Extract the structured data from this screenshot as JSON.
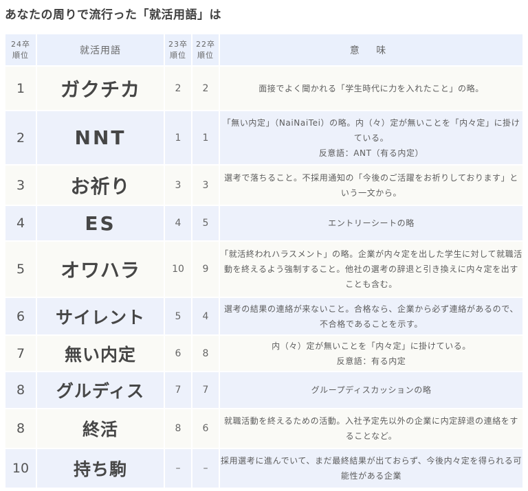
{
  "title": "あなたの周りで流行った「就活用語」は",
  "table": {
    "headers": {
      "rank24": [
        "24卒",
        "順位"
      ],
      "term": "就活用語",
      "rank23": [
        "23卒",
        "順位"
      ],
      "rank22": [
        "22卒",
        "順位"
      ],
      "meaning": "意 味"
    },
    "rows": [
      {
        "rank24": "1",
        "term": "ガクチカ",
        "rank23": "2",
        "rank22": "2",
        "meaning": [
          "面接でよく聞かれる「学生時代に力を入れたこと」の略。"
        ]
      },
      {
        "rank24": "2",
        "term": "NNT",
        "rank23": "1",
        "rank22": "1",
        "meaning": [
          "「無い内定」（NaiNaiTei）の略。内（々）定が無いことを「内々定」に掛けている。",
          "反意語：ANT（有る内定）"
        ]
      },
      {
        "rank24": "3",
        "term": "お祈り",
        "rank23": "3",
        "rank22": "3",
        "meaning": [
          "選考で落ちること。不採用通知の「今後のご活躍をお祈りしております」という一文から。"
        ]
      },
      {
        "rank24": "4",
        "term": "ES",
        "rank23": "4",
        "rank22": "5",
        "meaning": [
          "エントリーシートの略"
        ]
      },
      {
        "rank24": "5",
        "term": "オワハラ",
        "rank23": "10",
        "rank22": "9",
        "meaning": [
          "「就活終われハラスメント」の略。企業が内々定を出した学生に対して就職活動を終えるよう強制すること。他社の選考の辞退と引き換えに内々定を出すことも含む。"
        ]
      },
      {
        "rank24": "6",
        "term": "サイレント",
        "rank23": "5",
        "rank22": "4",
        "meaning": [
          "選考の結果の連絡が来ないこと。合格なら、企業から必ず連絡があるので、不合格であることを示す。"
        ]
      },
      {
        "rank24": "7",
        "term": "無い内定",
        "rank23": "6",
        "rank22": "8",
        "meaning": [
          "内（々）定が無いことを「内々定」に掛けている。",
          "反意語：有る内定"
        ]
      },
      {
        "rank24": "8",
        "term": "グルディス",
        "rank23": "7",
        "rank22": "7",
        "meaning": [
          "グループディスカッションの略"
        ]
      },
      {
        "rank24": "8",
        "term": "終活",
        "rank23": "8",
        "rank22": "6",
        "meaning": [
          "就職活動を終えるための活動。入社予定先以外の企業に内定辞退の連絡をすることなど。"
        ]
      },
      {
        "rank24": "10",
        "term": "持ち駒",
        "rank23": "–",
        "rank22": "–",
        "meaning": [
          "採用選考に進んでいて、まだ最終結果が出ておらず、今後内々定を得られる可能性がある企業"
        ]
      }
    ]
  }
}
